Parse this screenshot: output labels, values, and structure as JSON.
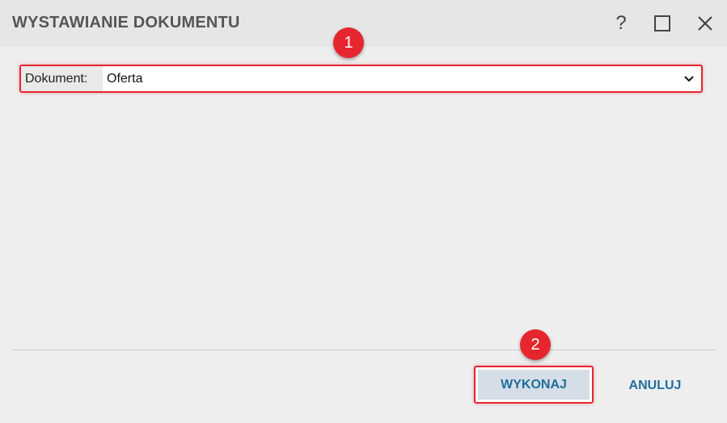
{
  "window": {
    "title": "WYSTAWIANIE DOKUMENTU",
    "help_label": "?",
    "icons": [
      "help-icon",
      "maximize-icon",
      "close-icon"
    ]
  },
  "form": {
    "document_label": "Dokument:",
    "document_value": "Oferta"
  },
  "annotations": {
    "badge1": "1",
    "badge2": "2"
  },
  "footer": {
    "execute_label": "WYKONAJ",
    "cancel_label": "ANULUJ"
  },
  "colors": {
    "accent_red": "#e5262e",
    "button_text_blue": "#1f6e9e",
    "primary_button_bg": "#d5dee6",
    "dialog_bg": "#eeeeee"
  }
}
